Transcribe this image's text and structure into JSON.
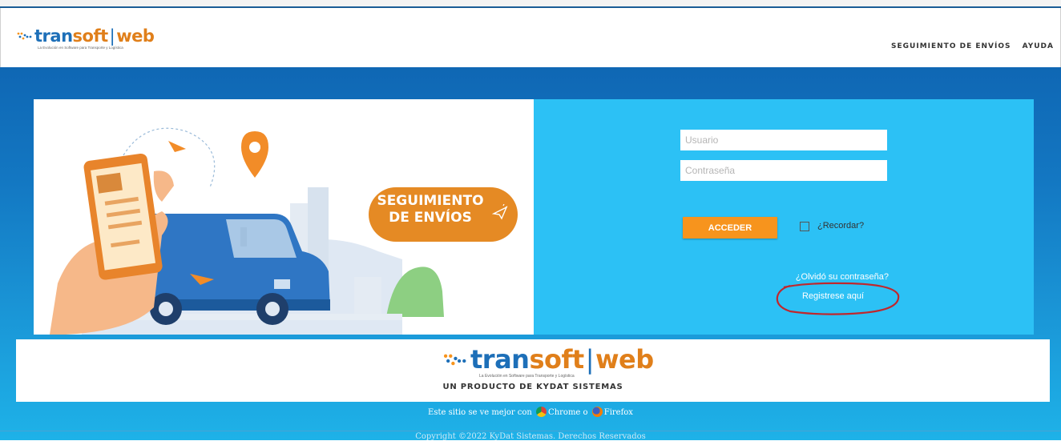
{
  "header": {
    "logo": {
      "part1": "tran",
      "part2": "soft",
      "sep": "|",
      "part3": "web",
      "tagline": "La Evolución en Software para Transporte y Logística"
    },
    "nav": [
      {
        "label": "SEGUIMIENTO DE ENVÍOS"
      },
      {
        "label": "AYUDA"
      }
    ]
  },
  "hero": {
    "badge_line1": "SEGUIMIENTO",
    "badge_line2": "DE ENVÍOS"
  },
  "login": {
    "username_placeholder": "Usuario",
    "password_placeholder": "Contraseña",
    "submit_label": "ACCEDER",
    "remember_label": "¿Recordar?",
    "forgot_label": "¿Olvidó su contraseña?",
    "register_label": "Registrese aquí"
  },
  "footer": {
    "logo": {
      "part1": "tran",
      "part2": "soft",
      "sep": "|",
      "part3": "web",
      "tagline": "La Evolución en Software para Transporte y Logística"
    },
    "product": "UN PRODUCTO DE KYDAT SISTEMAS",
    "browsers_prefix": "Este sitio se ve mejor con",
    "browser1": "Chrome",
    "browsers_or": "o",
    "browser2": "Firefox",
    "copyright": "Copyright ©2022 KyDat Sistemas. Derechos Reservados"
  },
  "colors": {
    "accent": "#f7941d",
    "brand_blue": "#1d6fb8",
    "panel": "#2cc1f5",
    "annotation_circle": "#c0272d"
  }
}
